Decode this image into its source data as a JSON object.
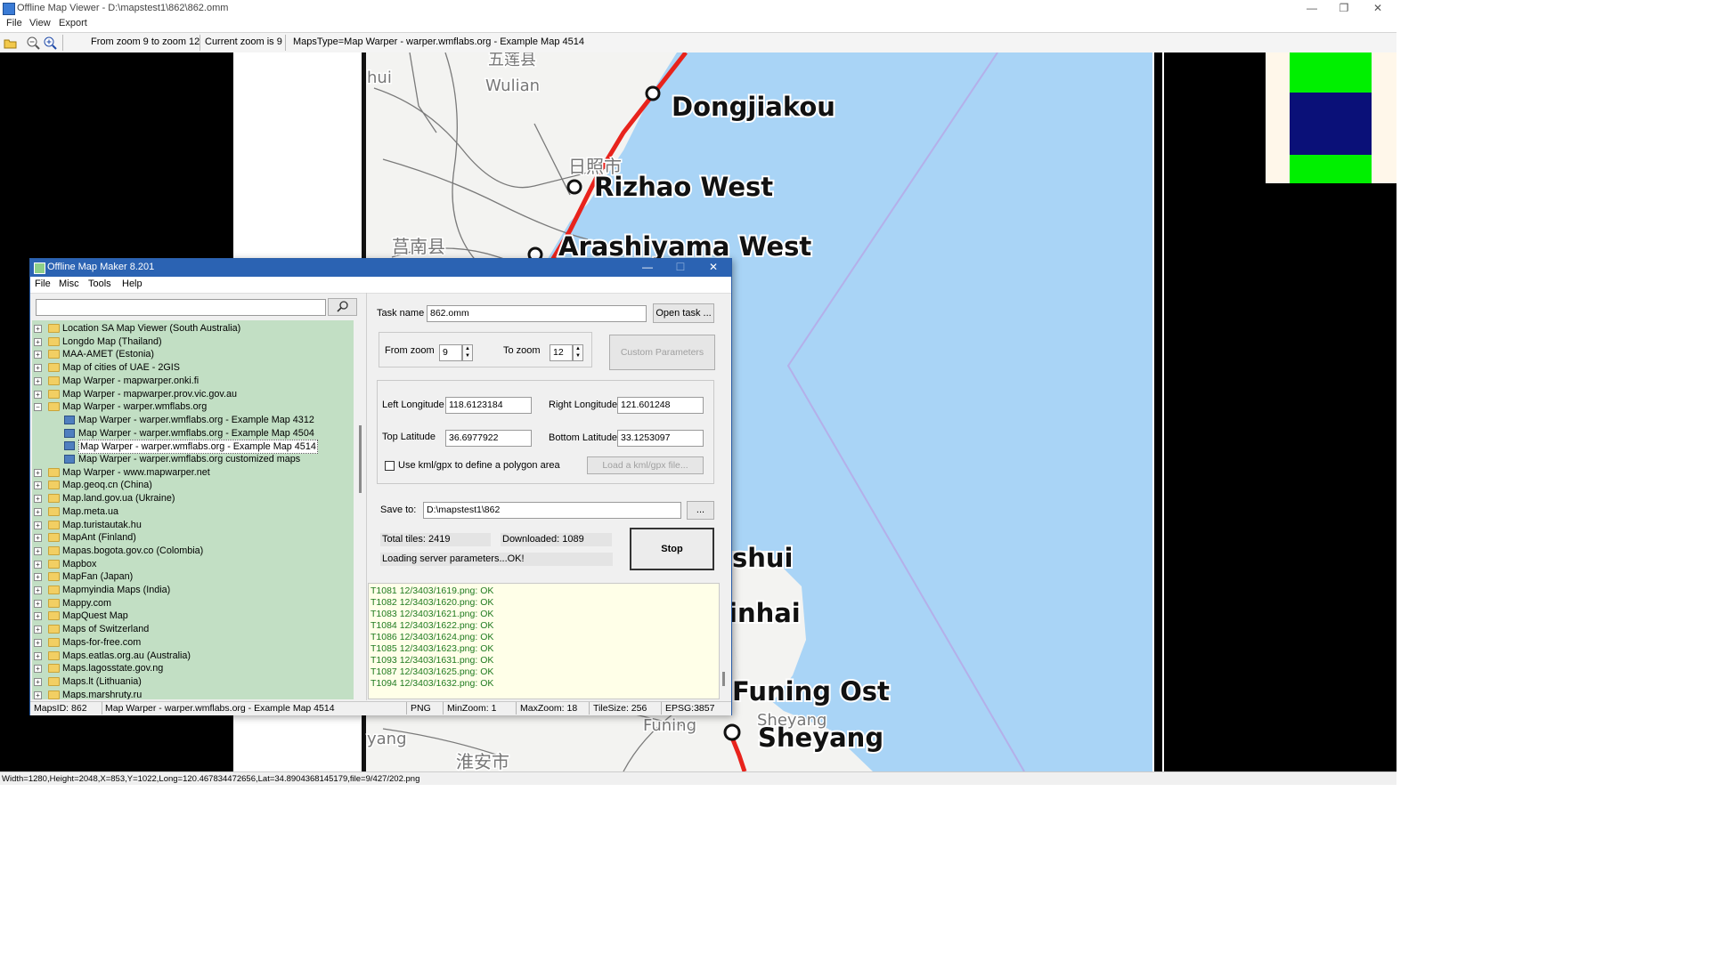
{
  "window": {
    "title": "Offline Map Viewer - D:\\mapstest1\\862\\862.omm",
    "buttons": {
      "minimize": "—",
      "restore": "❐",
      "close": "✕"
    }
  },
  "menu": [
    "File",
    "View",
    "Export"
  ],
  "toolbar": {
    "zoom_range": "From zoom 9 to zoom 12",
    "current_zoom": "Current zoom is 9",
    "maps_type": "MapsType=Map Warper - warper.wmflabs.org - Example Map 4514"
  },
  "map": {
    "cities": [
      "Dongjiakou",
      "Rizhao West",
      "Arashiyama West",
      "Funing Ost",
      "Sheyang"
    ],
    "cut_labels": [
      "shui",
      "inhai"
    ],
    "small_labels": [
      "Wulian",
      "Sheyang",
      "Funing",
      "hui",
      "yang",
      "五莲县",
      "日照市",
      "莒南县",
      "淮安市"
    ],
    "colors": {
      "sea": "#a9d4f6",
      "land": "#f3f3f1",
      "rail": "#e8231c",
      "thumb_green": "#00f000",
      "thumb_blue": "#0a1078",
      "thumb_bg": "#fff7ea"
    }
  },
  "viewer_status": "Width=1280,Height=2048,X=853,Y=1022,Long=120.467834472656,Lat=34.8904368145179,file=9/427/202.png",
  "dialog": {
    "title": "Offline Map Maker 8.201",
    "buttons": {
      "minimize": "—",
      "maximize": "☐",
      "close": "✕"
    },
    "menu": [
      "File",
      "Misc",
      "Tools",
      "Help"
    ],
    "search": {
      "value": "",
      "icon": "search-icon"
    },
    "tree": [
      {
        "label": "Location SA Map Viewer (South Australia)",
        "level": 0,
        "kind": "folder",
        "expander": "+"
      },
      {
        "label": "Longdo Map (Thailand)",
        "level": 0,
        "kind": "folder",
        "expander": "+"
      },
      {
        "label": "MAA-AMET (Estonia)",
        "level": 0,
        "kind": "folder",
        "expander": "+"
      },
      {
        "label": "Map of cities of UAE - 2GIS",
        "level": 0,
        "kind": "folder",
        "expander": "+"
      },
      {
        "label": "Map Warper - mapwarper.onki.fi",
        "level": 0,
        "kind": "folder",
        "expander": "+"
      },
      {
        "label": "Map Warper - mapwarper.prov.vic.gov.au",
        "level": 0,
        "kind": "folder",
        "expander": "+"
      },
      {
        "label": "Map Warper - warper.wmflabs.org",
        "level": 0,
        "kind": "folder",
        "expander": "−"
      },
      {
        "label": "Map Warper - warper.wmflabs.org - Example Map 4312",
        "level": 1,
        "kind": "map",
        "expander": ""
      },
      {
        "label": "Map Warper - warper.wmflabs.org - Example Map 4504",
        "level": 1,
        "kind": "map",
        "expander": ""
      },
      {
        "label": "Map Warper - warper.wmflabs.org - Example Map 4514",
        "level": 1,
        "kind": "map",
        "expander": "",
        "selected": true
      },
      {
        "label": "Map Warper - warper.wmflabs.org customized maps",
        "level": 1,
        "kind": "map",
        "expander": ""
      },
      {
        "label": "Map Warper - www.mapwarper.net",
        "level": 0,
        "kind": "folder",
        "expander": "+"
      },
      {
        "label": "Map.geoq.cn (China)",
        "level": 0,
        "kind": "folder",
        "expander": "+"
      },
      {
        "label": "Map.land.gov.ua (Ukraine)",
        "level": 0,
        "kind": "folder",
        "expander": "+"
      },
      {
        "label": "Map.meta.ua",
        "level": 0,
        "kind": "folder",
        "expander": "+"
      },
      {
        "label": "Map.turistautak.hu",
        "level": 0,
        "kind": "folder",
        "expander": "+"
      },
      {
        "label": "MapAnt (Finland)",
        "level": 0,
        "kind": "folder",
        "expander": "+"
      },
      {
        "label": "Mapas.bogota.gov.co (Colombia)",
        "level": 0,
        "kind": "folder",
        "expander": "+"
      },
      {
        "label": "Mapbox",
        "level": 0,
        "kind": "folder",
        "expander": "+"
      },
      {
        "label": "MapFan (Japan)",
        "level": 0,
        "kind": "folder",
        "expander": "+"
      },
      {
        "label": "Mapmyindia Maps (India)",
        "level": 0,
        "kind": "folder",
        "expander": "+"
      },
      {
        "label": "Mappy.com",
        "level": 0,
        "kind": "folder",
        "expander": "+"
      },
      {
        "label": "MapQuest Map",
        "level": 0,
        "kind": "folder",
        "expander": "+"
      },
      {
        "label": "Maps of Switzerland",
        "level": 0,
        "kind": "folder",
        "expander": "+"
      },
      {
        "label": "Maps-for-free.com",
        "level": 0,
        "kind": "folder",
        "expander": "+"
      },
      {
        "label": "Maps.eatlas.org.au (Australia)",
        "level": 0,
        "kind": "folder",
        "expander": "+"
      },
      {
        "label": "Maps.lagosstate.gov.ng",
        "level": 0,
        "kind": "folder",
        "expander": "+"
      },
      {
        "label": "Maps.lt (Lithuania)",
        "level": 0,
        "kind": "folder",
        "expander": "+"
      },
      {
        "label": "Maps.marshruty.ru",
        "level": 0,
        "kind": "folder",
        "expander": "+"
      }
    ],
    "task": {
      "label": "Task name",
      "value": "862.omm",
      "open_button": "Open task ..."
    },
    "zoom": {
      "from_label": "From zoom",
      "from_value": "9",
      "to_label": "To zoom",
      "to_value": "12",
      "custom_button": "Custom Parameters"
    },
    "coords": {
      "left_lon_label": "Left Longitude",
      "left_lon": "118.6123184",
      "right_lon_label": "Right Longitude",
      "right_lon": "121.601248",
      "top_lat_label": "Top Latitude",
      "top_lat": "36.6977922",
      "bottom_lat_label": "Bottom Latitude",
      "bottom_lat": "33.1253097",
      "kml_checkbox_label": "Use kml/gpx to define a polygon area",
      "kml_checked": false,
      "load_kml_button": "Load a kml/gpx file..."
    },
    "save": {
      "label": "Save to:",
      "value": "D:\\mapstest1\\862",
      "browse_button": "..."
    },
    "progress": {
      "total_tiles": "Total tiles: 2419",
      "downloaded": "Downloaded: 1089",
      "status": "Loading server parameters...OK!",
      "stop_button": "Stop"
    },
    "log": [
      "T1081 12/3403/1619.png: OK",
      "T1082 12/3403/1620.png: OK",
      "T1083 12/3403/1621.png: OK",
      "T1084 12/3403/1622.png: OK",
      "T1086 12/3403/1624.png: OK",
      "T1085 12/3403/1623.png: OK",
      "T1093 12/3403/1631.png: OK",
      "T1087 12/3403/1625.png: OK",
      "T1094 12/3403/1632.png: OK"
    ],
    "status_bar": {
      "maps_id": "MapsID: 862",
      "map_name": "Map Warper - warper.wmflabs.org - Example Map 4514",
      "format": "PNG",
      "min_zoom": "MinZoom: 1",
      "max_zoom": "MaxZoom: 18",
      "tile_size": "TileSize: 256",
      "epsg": "EPSG:3857"
    }
  }
}
